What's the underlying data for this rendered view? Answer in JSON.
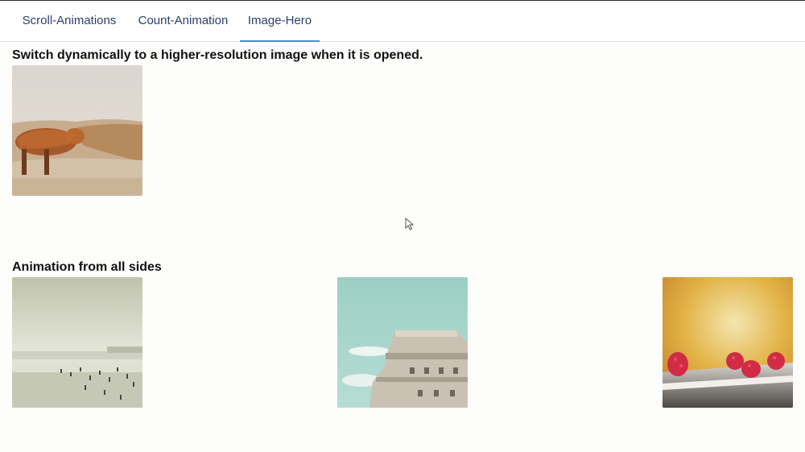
{
  "tabs": [
    {
      "label": "Scroll-Animations",
      "active": false
    },
    {
      "label": "Count-Animation",
      "active": false
    },
    {
      "label": "Image-Hero",
      "active": true
    }
  ],
  "sections": {
    "hero": {
      "title": "Switch dynamically to a higher-resolution image when it is opened."
    },
    "sides": {
      "title": "Animation from all sides"
    }
  },
  "colors": {
    "accent": "#4a8ad6",
    "tab_text": "#2c3e6b",
    "background": "#fdfdfb"
  }
}
